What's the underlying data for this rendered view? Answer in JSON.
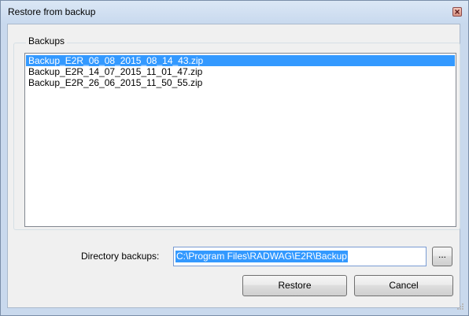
{
  "window": {
    "title": "Restore from backup"
  },
  "backups_group": {
    "label": "Backups",
    "items": [
      {
        "name": "Backup_E2R_06_08_2015_08_14_43.zip",
        "selected": true
      },
      {
        "name": "Backup_E2R_14_07_2015_11_01_47.zip",
        "selected": false
      },
      {
        "name": "Backup_E2R_26_06_2015_11_50_55.zip",
        "selected": false
      }
    ]
  },
  "directory": {
    "label": "Directory backups:",
    "value": "C:\\Program Files\\RADWAG\\E2R\\Backup",
    "browse_label": "..."
  },
  "actions": {
    "restore_label": "Restore",
    "cancel_label": "Cancel"
  },
  "colors": {
    "selection": "#3399ff",
    "title_bar": "#c9d9ed",
    "dialog_bg": "#f0f0f0"
  },
  "icons": {
    "close": "close-icon",
    "resize": "resize-grip-icon"
  }
}
